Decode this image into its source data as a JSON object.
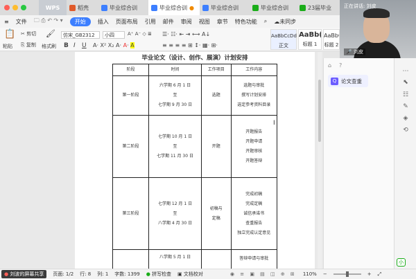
{
  "tabs": [
    {
      "label": "WPS",
      "kind": "wps"
    },
    {
      "label": "稻壳",
      "icon_color": "#e05a2a"
    },
    {
      "label": "毕业综合训",
      "icon_color": "#3d7fff"
    },
    {
      "label": "毕业综合训",
      "icon_color": "#3d7fff",
      "active": true
    },
    {
      "label": "毕业综合训",
      "icon_color": "#3d7fff"
    },
    {
      "label": "毕业综合训",
      "icon_color": "#1aad19"
    },
    {
      "label": "23届毕业",
      "icon_color": "#1aad19"
    }
  ],
  "menu": {
    "file": "文件",
    "items": [
      "开始",
      "插入",
      "页面布局",
      "引用",
      "邮件",
      "审阅",
      "视图",
      "章节",
      "特色功能"
    ],
    "sync": "未同步"
  },
  "toolbar": {
    "paste": "粘贴",
    "cut": "剪切",
    "copy": "复制",
    "format_painter": "格式刷",
    "font_name": "仿宋_GB2312",
    "font_size": "小四",
    "style_preview_1": "AaBbCcDd",
    "style_name_1": "正文",
    "style_preview_2": "AaBb(",
    "style_name_2": "标题 1",
    "style_preview_3": "AaBbCc",
    "style_name_3": "标题 2"
  },
  "video": {
    "speaking": "正在讲话: 刘皮",
    "name": "刘皮"
  },
  "document": {
    "title": "毕业论文（设计、创作、展演）计划安排",
    "headers": [
      "阶段",
      "时间",
      "工作项目",
      "工作内容"
    ],
    "rows": [
      {
        "stage": "第一阶段",
        "time": [
          "六学期 6 月 1 日",
          "至",
          "七学期 9 月 30 日"
        ],
        "project": [
          "选题"
        ],
        "content": [
          "选题与审批",
          "撰写计划安排",
          "选定参考资料目录"
        ]
      },
      {
        "stage": "第二阶段",
        "time": [
          "七学期 10 月 1 日",
          "至",
          "七学期 11 月 30 日"
        ],
        "project": [
          "开题"
        ],
        "content": [
          "开题报告",
          "开题申请",
          "开题审核",
          "开题答辩"
        ]
      },
      {
        "stage": "第三阶段",
        "time": [
          "七学期 12 月 1 日",
          "至",
          "八学期 4 月 30 日"
        ],
        "project": [
          "初稿与",
          "定稿"
        ],
        "content": [
          "完成初稿",
          "完成定稿",
          "诚信承诺书",
          "查重报告",
          "独立完成认定意见"
        ]
      },
      {
        "stage": "",
        "time": [
          "八学期 5 月 1 日"
        ],
        "project": [
          ""
        ],
        "content": [
          "答辩申请与审批"
        ]
      }
    ]
  },
  "right_panel": {
    "paper_check": "论文查重"
  },
  "status": {
    "share": "刘波的屏幕共享",
    "page": "页面: 1/2",
    "line": "行: 8",
    "col": "列: 1",
    "wordcount": "字数: 1399",
    "spell": "拼写检查",
    "proof": "文档校对",
    "zoom": "110%"
  },
  "wechat_badge": "小"
}
